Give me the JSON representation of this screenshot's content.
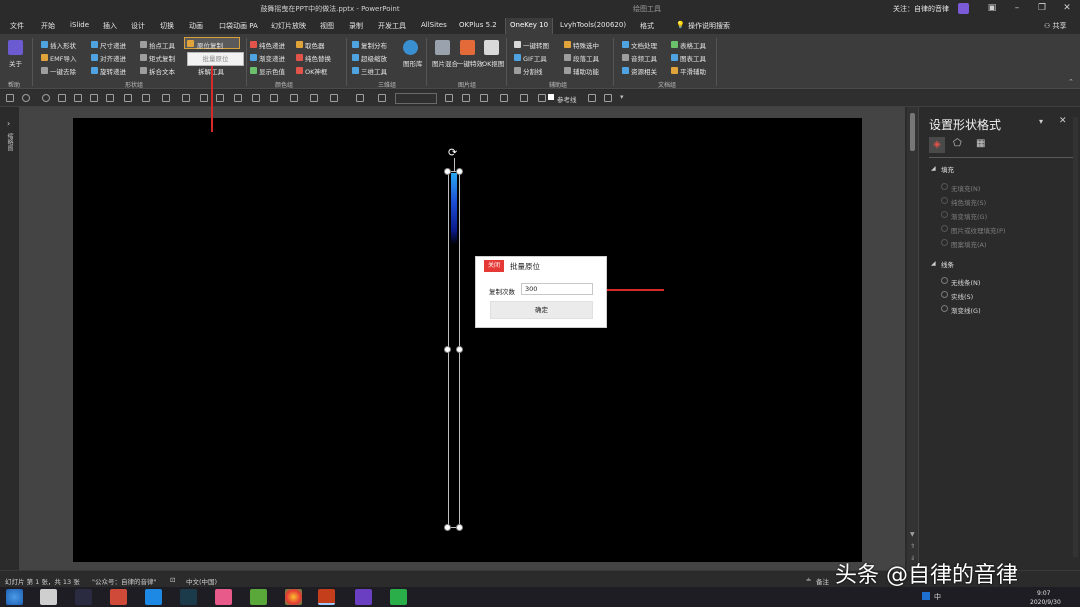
{
  "window": {
    "title": "鼓舞摇曳在PPT中的做法.pptx - PowerPoint",
    "tool_context": "绘图工具",
    "follow_text": "关注：自律的音律",
    "share": "共享"
  },
  "tabs": [
    {
      "label": "文件"
    },
    {
      "label": "开始"
    },
    {
      "label": "iSlide"
    },
    {
      "label": "插入"
    },
    {
      "label": "设计"
    },
    {
      "label": "切换"
    },
    {
      "label": "动画"
    },
    {
      "label": "口袋动画 PA"
    },
    {
      "label": "幻灯片放映"
    },
    {
      "label": "视图"
    },
    {
      "label": "录制"
    },
    {
      "label": "开发工具"
    },
    {
      "label": "AllSites"
    },
    {
      "label": "OKPlus 5.2"
    },
    {
      "label": "OneKey 10"
    },
    {
      "label": "LvyhTools(200620)"
    },
    {
      "label": "格式"
    },
    {
      "label": "操作说明搜索"
    }
  ],
  "ribbon": {
    "about": "关于",
    "help_label": "帮助",
    "shape_group": {
      "items": [
        "插入形状",
        "EMF导入",
        "一键去除",
        "尺寸递进",
        "对齐递进",
        "旋转递进",
        "拾点工具",
        "矩式复制",
        "拆合文本",
        "原位复制",
        "拆解工具"
      ],
      "label": "形状组"
    },
    "dropdown_item": "批量原位",
    "color_group": {
      "items": [
        "纯色递进",
        "渐变递进",
        "显示色值",
        "取色器",
        "纯色替换",
        "OK神框"
      ],
      "label": "颜色组"
    },
    "3d_group": {
      "items": [
        "复制分布",
        "超级缩放",
        "三维工具",
        "图形库"
      ],
      "label": "三维组"
    },
    "image_group": {
      "items": [
        "图片混合",
        "一键特效",
        "OK抠图"
      ],
      "label": "图片组"
    },
    "assist_group": {
      "items": [
        "一键转图",
        "GIF工具",
        "分割线",
        "特殊选中",
        "段落工具",
        "辅助功能"
      ],
      "label": "辅助组"
    },
    "doc_group": {
      "items": [
        "文档处理",
        "音频工具",
        "资源相关",
        "表格工具",
        "图表工具",
        "平滑辅助"
      ],
      "label": "文档组"
    }
  },
  "qat": {
    "reference_line": "参考线"
  },
  "left_pane": {
    "label": "缩略图"
  },
  "dialog": {
    "close_label": "关闭",
    "title": "批量原位",
    "count_label": "复制次数",
    "count_value": "300",
    "ok_label": "确定"
  },
  "format_pane": {
    "title": "设置形状格式",
    "fill_section": "填充",
    "fill_options": [
      "无填充(N)",
      "纯色填充(S)",
      "渐变填充(G)",
      "图片或纹理填充(P)",
      "图案填充(A)"
    ],
    "line_section": "线条",
    "line_options": [
      "无线条(N)",
      "实线(S)",
      "渐变线(G)"
    ]
  },
  "status_bar": {
    "slide_info": "幻灯片 第 1 张，共 13 张",
    "wechat": "\"公众号：自律的音律\"",
    "language": "中文(中国)",
    "notes": "备注"
  },
  "taskbar": {
    "time": "9:07",
    "date": "2020/9/30"
  },
  "watermark": "头条 @自律的音律",
  "colors": {
    "accent_red": "#e53935",
    "slide_bg": "#000000",
    "ribbon_bg": "#3c3c3c"
  }
}
